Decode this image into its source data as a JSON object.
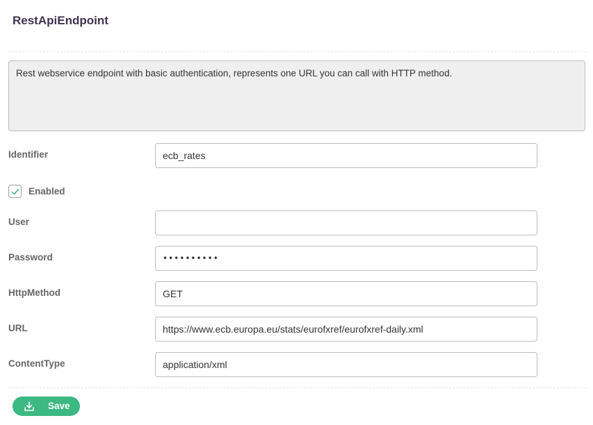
{
  "header": {
    "title": "RestApiEndpoint"
  },
  "description": "Rest webservice endpoint with basic authentication, represents one URL you can call with HTTP method.",
  "form": {
    "identifier": {
      "label": "Identifier",
      "value": "ecb_rates"
    },
    "enabled": {
      "label": "Enabled",
      "checked": true
    },
    "user": {
      "label": "User",
      "value": ""
    },
    "password": {
      "label": "Password",
      "value": "••••••••••"
    },
    "http_method": {
      "label": "HttpMethod",
      "value": "GET"
    },
    "url": {
      "label": "URL",
      "value": "https://www.ecb.europa.eu/stats/eurofxref/eurofxref-daily.xml"
    },
    "content_type": {
      "label": "ContentType",
      "value": "application/xml"
    }
  },
  "actions": {
    "save_label": "Save",
    "save_icon": "download-icon"
  },
  "colors": {
    "accent": "#3cb882",
    "title": "#3d3452"
  }
}
